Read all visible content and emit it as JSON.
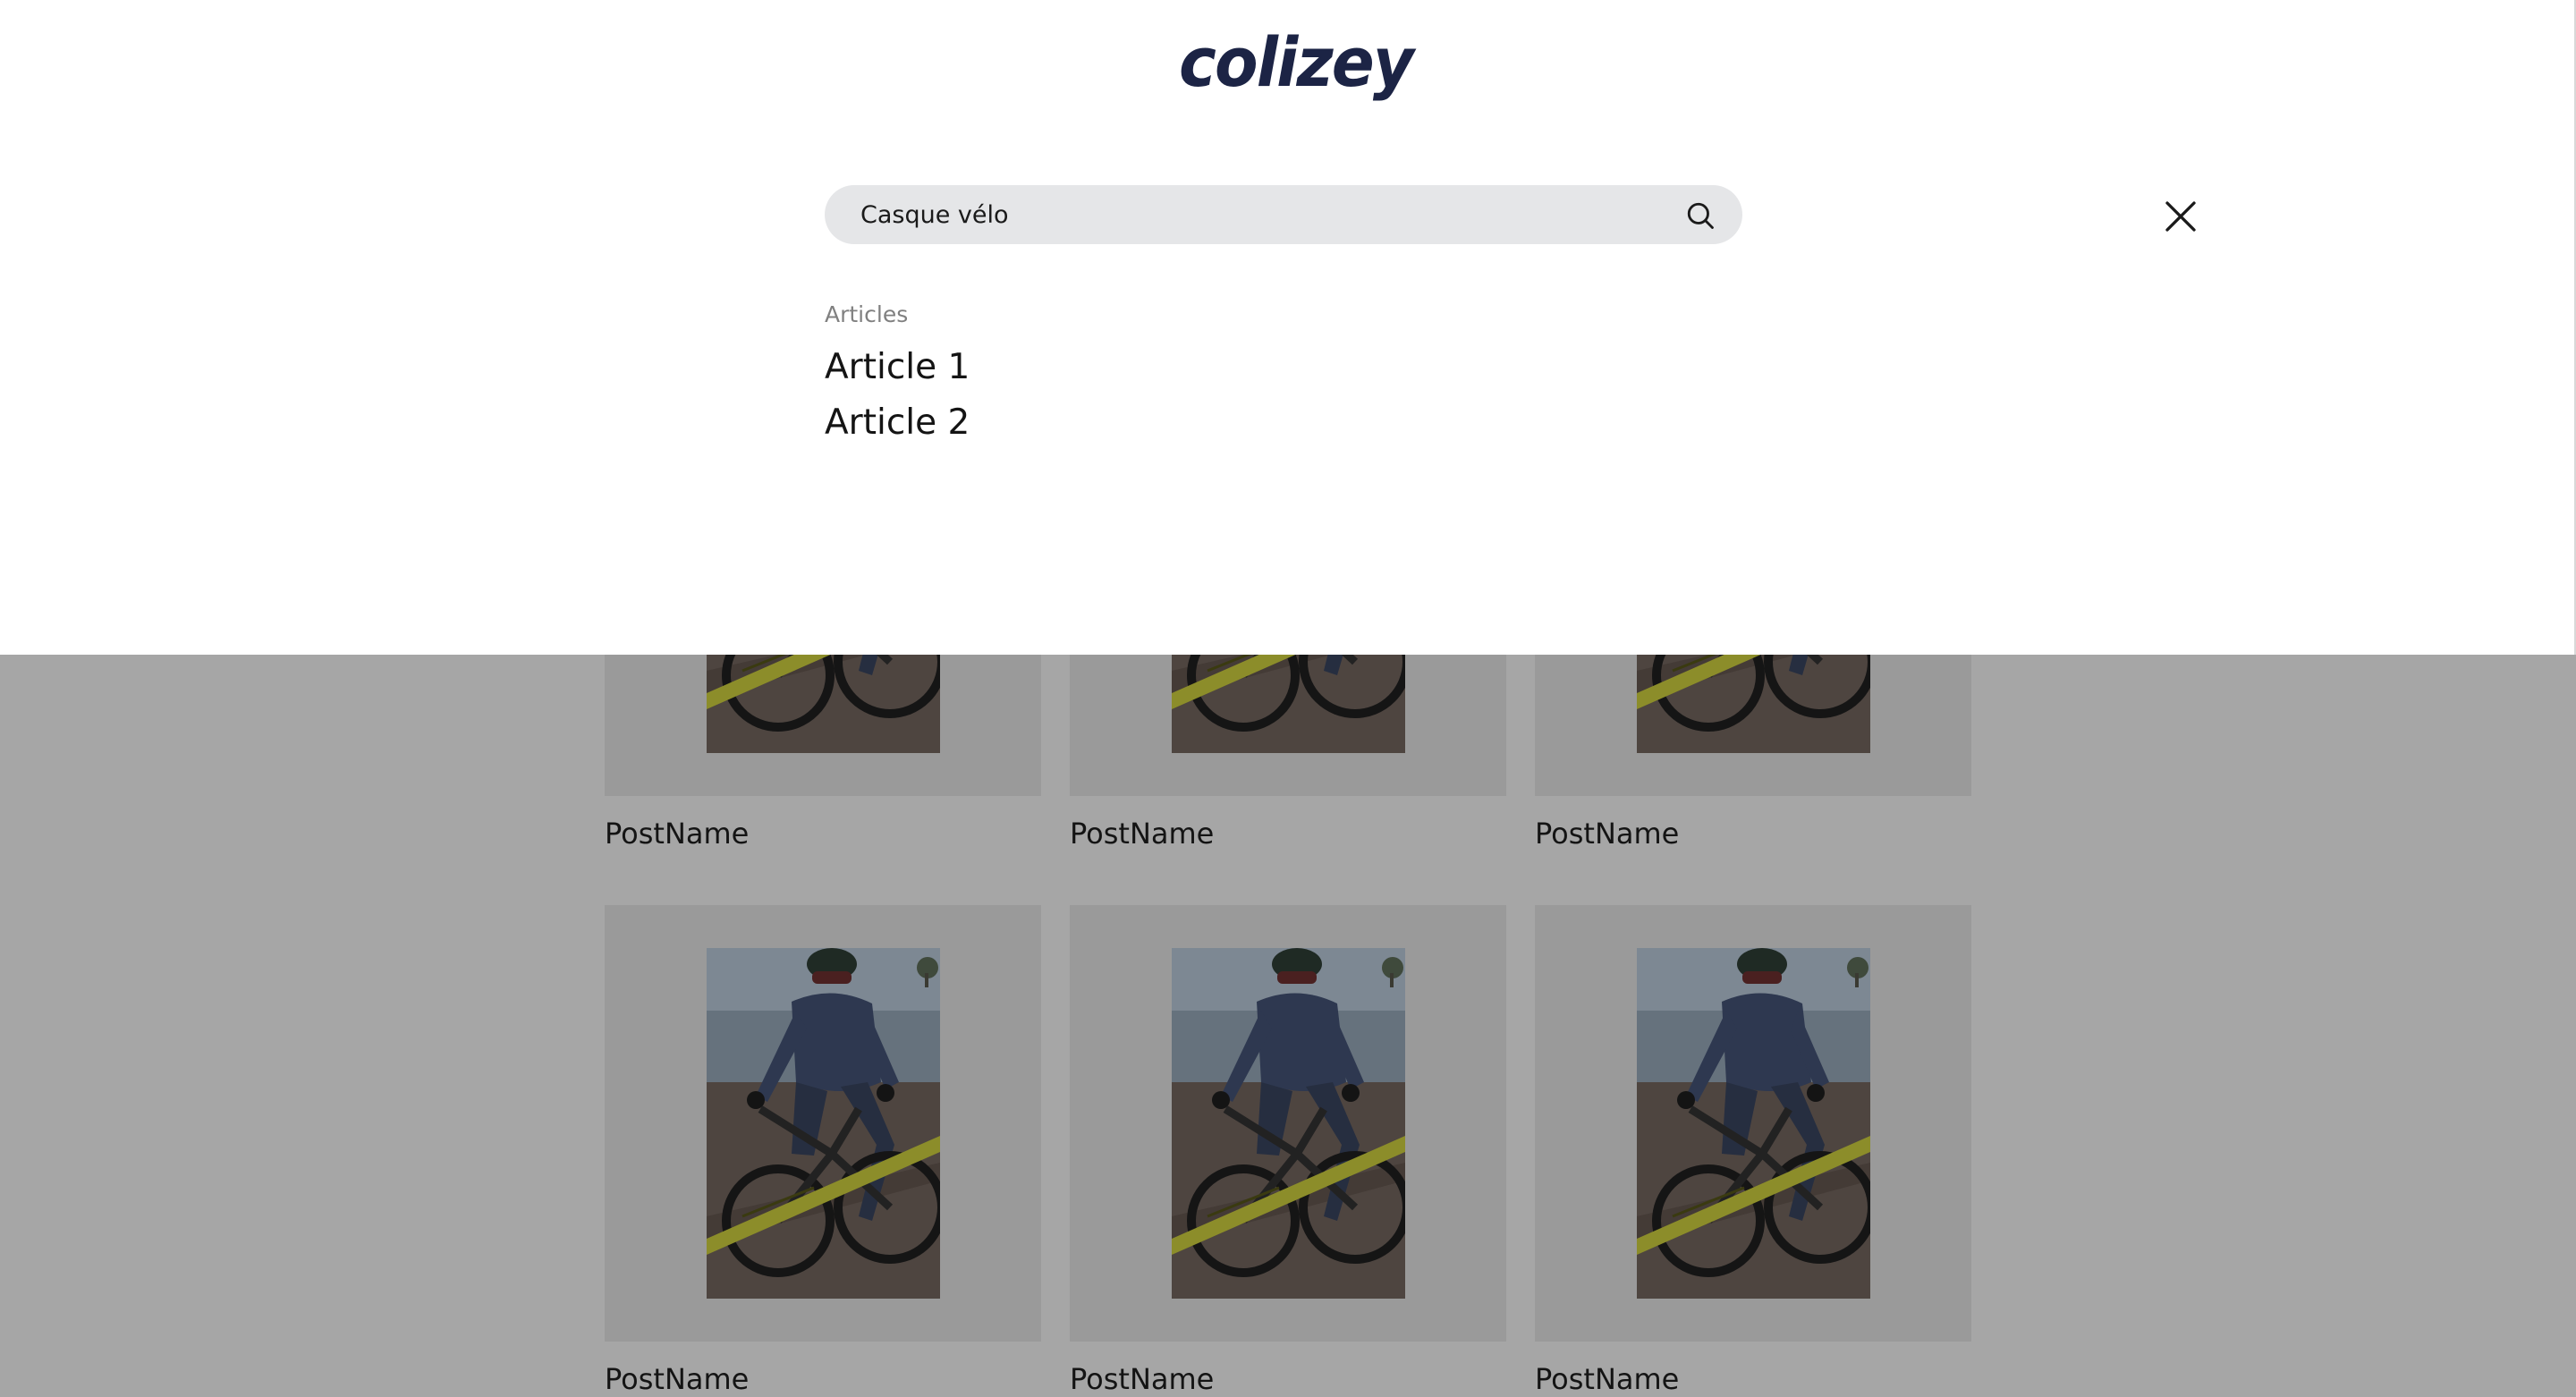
{
  "brand": {
    "logo_text": "colizey",
    "logo_color": "#1c2445"
  },
  "search": {
    "value": "Casque vélo",
    "placeholder": "",
    "icon": "search-icon"
  },
  "close": {
    "icon": "close-icon"
  },
  "results": {
    "heading": "Articles",
    "items": [
      {
        "label": "Article 1"
      },
      {
        "label": "Article 2"
      }
    ]
  },
  "posts": [
    {
      "name": "PostName"
    },
    {
      "name": "PostName"
    },
    {
      "name": "PostName"
    },
    {
      "name": "PostName"
    },
    {
      "name": "PostName"
    },
    {
      "name": "PostName"
    }
  ],
  "colors": {
    "overlay": "#a6a6a6",
    "panel": "#ffffff",
    "search_bg": "#e5e6e8"
  }
}
